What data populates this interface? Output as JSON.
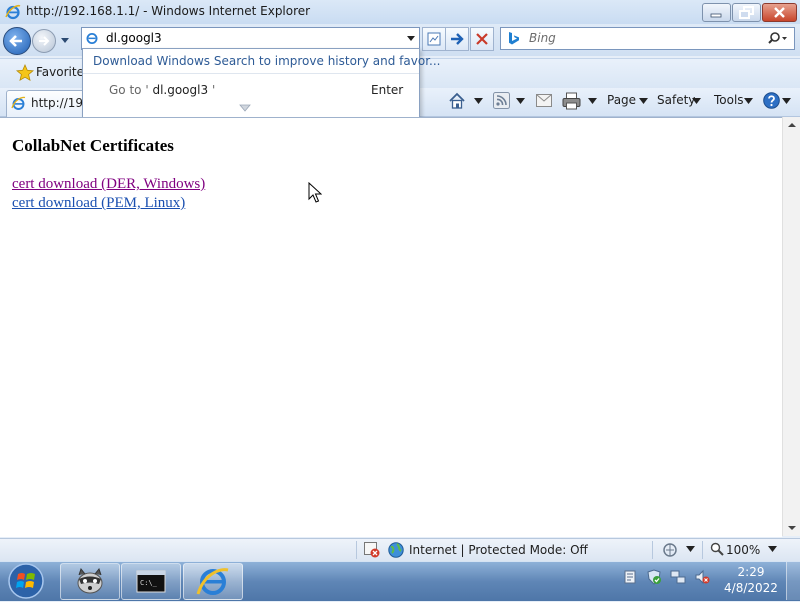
{
  "window": {
    "title": "http://192.168.1.1/ - Windows Internet Explorer"
  },
  "address_bar": {
    "value": "dl.googl3"
  },
  "search": {
    "placeholder": "Bing"
  },
  "autocomplete": {
    "promo": "Download Windows Search to improve history and favor...",
    "goto_prefix": "Go to '",
    "goto_value": "dl.googl3",
    "goto_suffix": "'",
    "enter_label": "Enter"
  },
  "favorites": {
    "label": "Favorite"
  },
  "tab": {
    "label": "http://192"
  },
  "command_bar": {
    "page": "Page",
    "safety": "Safety",
    "tools": "Tools"
  },
  "page": {
    "heading": "CollabNet Certificates",
    "links": [
      {
        "label": "cert download (DER, Windows)",
        "visited": true
      },
      {
        "label": "cert download (PEM, Linux)",
        "visited": false
      }
    ]
  },
  "status_bar": {
    "zone": "Internet | Protected Mode: Off",
    "zoom": "100%"
  },
  "taskbar": {
    "time": "2:29",
    "date": "4/8/2022"
  },
  "colors": {
    "visited_link": "#800080",
    "link": "#1a4fb0",
    "taskbar": "#5f86b6"
  }
}
